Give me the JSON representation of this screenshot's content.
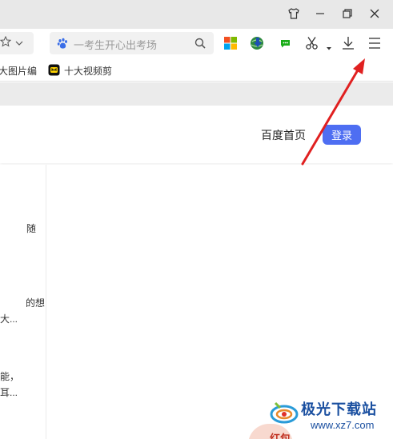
{
  "toolbar": {
    "search_placeholder": "一考生开心出考场"
  },
  "bookmarks": [
    {
      "label": "大图片编"
    },
    {
      "label": "十大视频剪"
    }
  ],
  "header": {
    "home_link": "百度首页",
    "login_label": "登录"
  },
  "left_panel": {
    "snippets": [
      "随",
      "的想",
      "大...",
      "能，",
      "耳..."
    ]
  },
  "watermark": {
    "title": "极光下载站",
    "url": "www.xz7.com"
  },
  "hongbao": {
    "label": "红包"
  },
  "colors": {
    "accent": "#4e6ef2",
    "annotation_arrow": "#e02020"
  }
}
